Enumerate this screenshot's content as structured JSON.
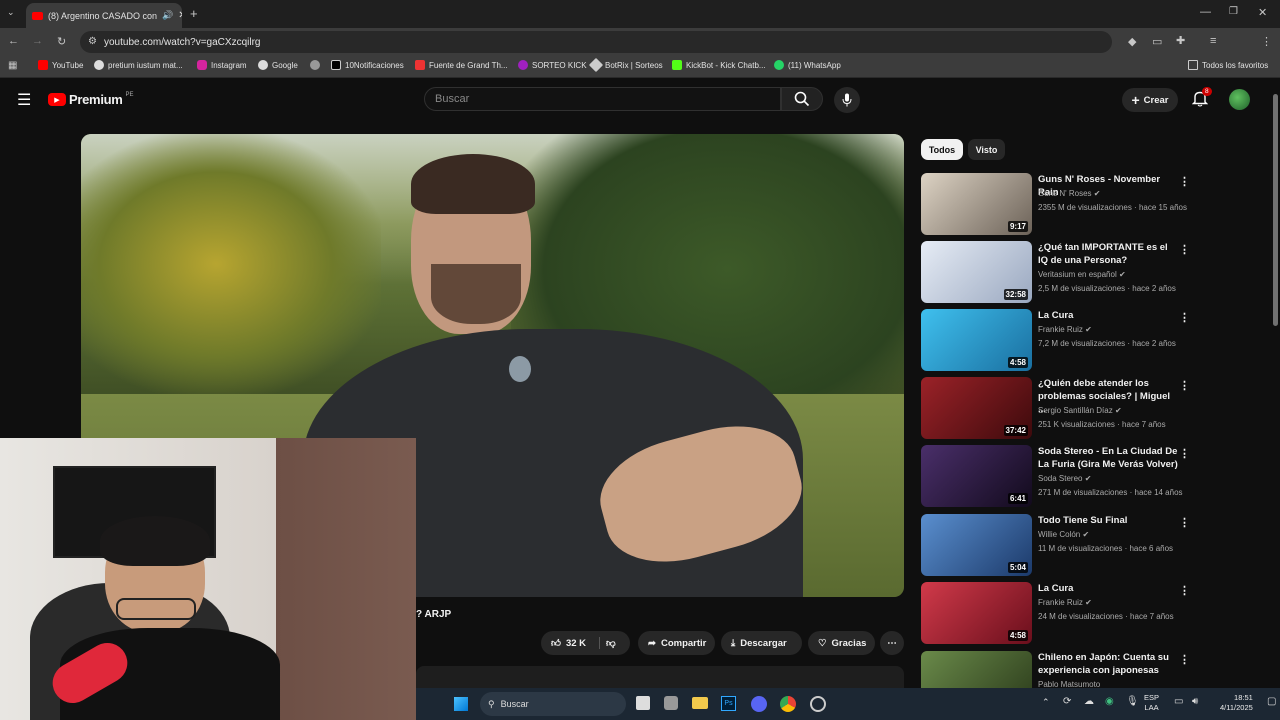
{
  "browser": {
    "tab_title": "(8) Argentino CASADO con",
    "url": "youtube.com/watch?v=gaCXzcqilrg",
    "bookmarks": [
      "YouTube",
      "pretium iustum mat...",
      "Instagram",
      "Google",
      "10Notificaciones",
      "Fuente de Grand Th...",
      "SORTEO KICK",
      "BotRix | Sorteos",
      "KickBot - Kick Chatb...",
      "(11) WhatsApp"
    ],
    "all_bookmarks": "Todos los favoritos"
  },
  "header": {
    "logo": "Premium",
    "region": "PE",
    "search_placeholder": "Buscar",
    "create_label": "Crear",
    "notif_count": "8"
  },
  "video": {
    "title_fragment": "? ARJP"
  },
  "actions": {
    "likes": "32 K",
    "share": "Compartir",
    "download": "Descargar",
    "thanks": "Gracias"
  },
  "chips": [
    "Todos",
    "Visto"
  ],
  "recommendations": [
    {
      "title": "Guns N' Roses - November Rain",
      "channel": "Guns N' Roses",
      "views": "2355 M de visualizaciones · hace 15 años",
      "duration": "9:17",
      "color": "#8a8278"
    },
    {
      "title": "¿Qué tan IMPORTANTE es el IQ de una Persona?",
      "channel": "Veritasium en español",
      "views": "2,5 M de visualizaciones · hace 2 años",
      "duration": "32:58",
      "color": "#b9c4d6"
    },
    {
      "title": "La Cura",
      "channel": "Frankie Ruiz",
      "views": "7,2 M de visualizaciones · hace 2 años",
      "duration": "4:58",
      "color": "#2aa7d6"
    },
    {
      "title": "¿Quién debe atender los problemas sociales? | Miguel ...",
      "channel": "Sergio Santillán Díaz",
      "views": "251 K visualizaciones · hace 7 años",
      "duration": "37:42",
      "color": "#7a1a1e"
    },
    {
      "title": "Soda Stereo - En La Ciudad De La Furia (Gira Me Verás Volver)",
      "channel": "Soda Stereo",
      "views": "271 M de visualizaciones · hace 14 años",
      "duration": "6:41",
      "color": "#2a1d3a"
    },
    {
      "title": "Todo Tiene Su Final",
      "channel": "Willie Colón",
      "views": "11 M de visualizaciones · hace 6 años",
      "duration": "5:04",
      "color": "#3a6fa8"
    },
    {
      "title": "La Cura",
      "channel": "Frankie Ruiz",
      "views": "24 M de visualizaciones · hace 7 años",
      "duration": "4:58",
      "color": "#b52a3a"
    },
    {
      "title": "Chileno en Japón: Cuenta su experiencia con japonesas",
      "channel": "Pablo Matsumoto",
      "views": "",
      "duration": "",
      "color": "#4a6a3a"
    }
  ],
  "taskbar": {
    "search": "Buscar",
    "lang1": "ESP",
    "lang2": "LAA",
    "time": "18:51",
    "date": "4/11/2025"
  }
}
